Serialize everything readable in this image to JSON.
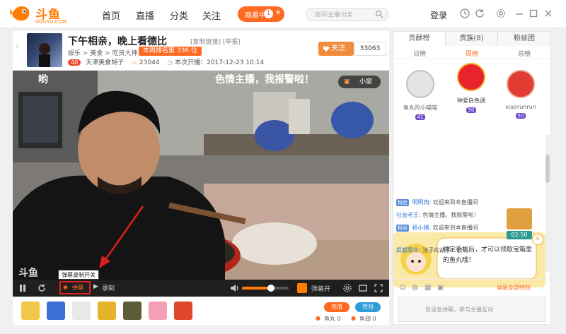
{
  "app": {
    "brand": "斗鱼",
    "domain": "DOUYU.COM"
  },
  "nav": {
    "home": "首页",
    "live": "直播",
    "category": "分类",
    "follow": "关注"
  },
  "watching": {
    "label": "观看中",
    "count": "1"
  },
  "search": {
    "placeholder": "房间/主播/分类"
  },
  "login": "登录",
  "room": {
    "title": "下午相亲，晚上看德比",
    "tags": "[复制链接] [举报]",
    "crumb": "娱乐 > 美食 > 吃货大神",
    "rank": "本周排名第 336 位",
    "host_level": "40",
    "host": "天津美食胡子",
    "heat": "23044",
    "start_time": "本次开播：2017-12-23 10:14",
    "follow_label": "关注",
    "follow_count": "33063"
  },
  "video": {
    "danmu1": "哟",
    "danmu2": "色情主播，我报警啦！",
    "small_window": "小窗",
    "watermark": "斗鱼"
  },
  "controls": {
    "tooltip": "弹幕录制开关",
    "danmu_label": "弹幕",
    "record_label": "录制",
    "danmu_open": "弹幕开"
  },
  "gifts_bar": {
    "recharge": "充值",
    "gift_pack": "背包",
    "fishball": "鱼丸 0",
    "fishwing": "鱼翅 0"
  },
  "side": {
    "tabs": [
      "贡献榜",
      "贵族(8)",
      "粉丝团"
    ],
    "subtabs": [
      "日榜",
      "周榜",
      "总榜"
    ],
    "top3": [
      {
        "name": "鱼丸的小喵喵",
        "level": "41",
        "color": "#cfcfcf"
      },
      {
        "name": "钟爱白色调",
        "level": "50",
        "color": "#f5b323"
      },
      {
        "name": "xiaorunrun",
        "level": "50",
        "color": "#e03c32"
      }
    ],
    "banner": "绑定手机后，才可以领取宝箱里的鱼丸哦！",
    "chat": [
      {
        "user": "明明肉:",
        "msg": "欢迎来到本直播间",
        "tag": "粉丝"
      },
      {
        "user": "社会老王:",
        "msg": "色情主播，我报警啦！",
        "tag": ""
      },
      {
        "user": "杨小猪:",
        "msg": "欢迎来到本直播间",
        "tag": "粉丝"
      },
      {
        "user": "提都靠牛:",
        "msg": "法子的胡子：歌说",
        "tag": ""
      }
    ],
    "chest_time": "02:50",
    "shield": "屏蔽全部特效",
    "input_placeholder": "登录发弹幕，参与主播互动"
  }
}
